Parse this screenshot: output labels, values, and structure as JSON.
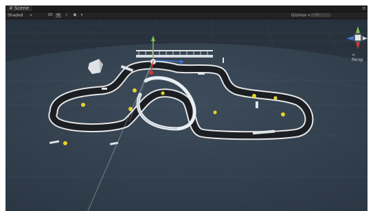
{
  "scene_tab": {
    "label": "Scene"
  },
  "toolbar": {
    "shading_mode": "Shaded",
    "dimension_toggle": "2D",
    "gizmos_label": "Gizmos",
    "search_placeholder": "All"
  },
  "scene_gizmo": {
    "projection_label": "< Persp"
  },
  "colors": {
    "sky": "#2e3a47",
    "ground": "#394756",
    "track": "#1b1e22",
    "track_border": "#e6e6e6",
    "cone": "#e6d22a",
    "gizmo_x": "#d43a2a",
    "gizmo_y": "#7ec24a",
    "gizmo_z": "#3f77d6"
  },
  "icons": [
    "hash-icon",
    "menu-icon",
    "caret-down-icon",
    "light-icon",
    "audio-icon",
    "effects-icon",
    "search-icon"
  ]
}
